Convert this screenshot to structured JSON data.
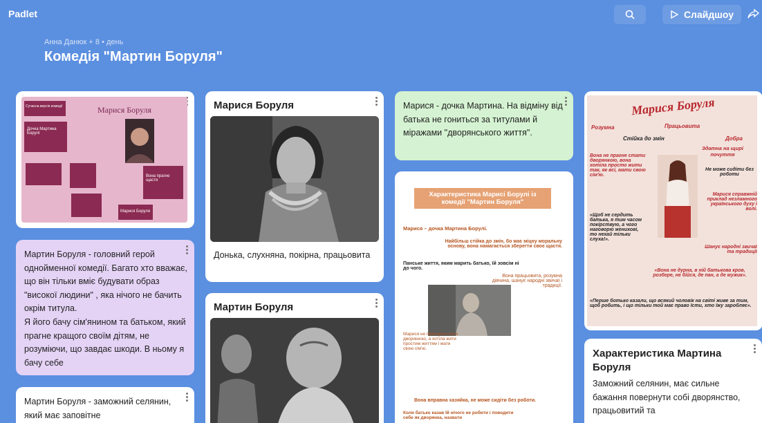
{
  "app": {
    "logo": "Padlet"
  },
  "toolbar": {
    "slideshow_label": "Слайдшоу"
  },
  "header": {
    "byline": "Анна Данюк + 8 • день",
    "title": "Комедія \"Мартин Боруля\""
  },
  "columns": {
    "col1": {
      "pink_card_text": "Мартин Боруля - головний герой однойменної комедії. Багато хто вважає, що він тільки вміє будувати образ \"високої людини\" , яка нічого не бачить окрім титула.\nЯ його бачу сім'янином та батьком, який прагне кращого своїм дітям, не розуміючи, що завдає шкоди. В ньому я бачу себе",
      "white_card_text": "Мартин Боруля  - заможний селянин, який   має заповітне"
    },
    "col2": {
      "card1_title": "Марися Боруля",
      "card1_caption": "Донька, слухняна, покірна, працьовита",
      "card2_title": "Мартин Боруля"
    },
    "col3": {
      "green_card_text": "Марися - дочка Мартина. На відміну від батька не гониться за титулами й міражами \"дворянського життя\"."
    },
    "col4": {
      "card2_title": "Характеристика Мартина Боруля",
      "card2_text": "Заможний селянин, має сильне бажання повернути собі дворянство, працьовитий та"
    }
  },
  "poster1": {
    "title": "Марися Боруля",
    "sub": "Сучасна версія комедії",
    "box1": "Дочка Мартина Борулі",
    "box2": "Вона прагне щастя",
    "box3": "Марися Боруля"
  },
  "poster2": {
    "heading": "Характеристика Марисі Борулі із комедії  \"Мартин Боруля\"",
    "line1": "Марися – дочка Мартина Борулі.",
    "line2": "Найбільш стійка до змін, бо має міцну моральну основу, вона намагається зберегти своє щастя.",
    "line3": "Панське життя, яким марить батько, їй зовсім ні до чого.",
    "line4": "Вона працьовита, розумна дівчина, шанує народні звичаї і традиції.",
    "line5": "Марися не прагнула стати дворянкою, а хотіла жити простим життям і мати свою сім'ю.",
    "line6": "Вона вправна хазяйка, не може сидіти без роботи.",
    "line7": "Коли батько казав їй нічого не робити і поводити себе як дворянка, назвати"
  },
  "poster3": {
    "title": "Марися Боруля",
    "w1": "Розумна",
    "w2": "Працьовита",
    "w3": "Добра",
    "w4": "Стійка до змін",
    "w5": "Здатна на щирі почуття",
    "p1": "Вона не прагне стати дворянкою, вона хотіла просто жити так, як всі, мати свою сім'ю.",
    "p2": "Не може сидіти без роботи",
    "p3": "Марися справжній приклад незламного українського духу і волі.",
    "p4": "«Щоб не сердить батька, я тим часом покірствую, а чого наговорю женихові, то нехай тільки слуха!».",
    "p5": "Шанує народні звичаї та традиції",
    "p6": "«Вона не дурна, в ній батькова кров, розбере, не бійся, де пан, а де мужик».",
    "p7": "«Перше ботько казали, що всякий чоловік на світі живе за тим, щоб робить, і що тільки той має право їсти, хто їжу заробляє»."
  },
  "colors": {
    "background": "#5b8fe0",
    "pink_card": "#e5d3f6",
    "green_card": "#d5f3d2"
  }
}
